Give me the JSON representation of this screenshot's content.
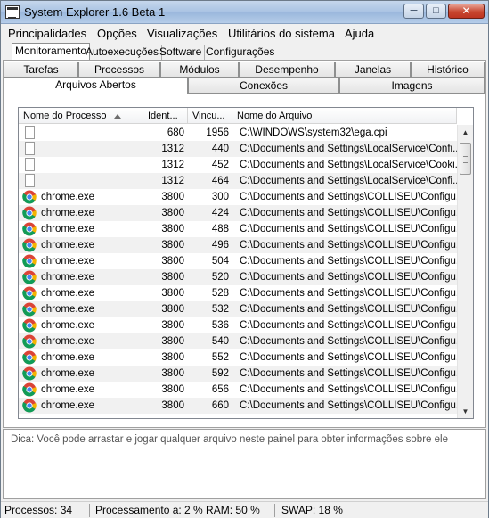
{
  "window": {
    "title": "System Explorer 1.6 Beta 1",
    "min_label": "─",
    "max_label": "□",
    "close_label": "✕"
  },
  "menu": [
    "Principalidades",
    "Opções",
    "Visualizações",
    "Utilitários do sistema",
    "Ajuda"
  ],
  "top_tabs": [
    "Monitoramento",
    "Autoexecuções",
    "Software",
    "Configurações"
  ],
  "tabs_row1": [
    "Tarefas",
    "Processos",
    "Módulos",
    "Desempenho",
    "Janelas",
    "Histórico"
  ],
  "tabs_row2": [
    "Arquivos Abertos",
    "Conexões",
    "Imagens"
  ],
  "columns": [
    "Nome do Processo",
    "Ident...",
    "Vincu...",
    "Nome do Arquivo"
  ],
  "rows": [
    {
      "name": "",
      "pid": "680",
      "link": "1956",
      "file": "C:\\WINDOWS\\system32\\ega.cpi",
      "icon": "document-icon"
    },
    {
      "name": "",
      "pid": "1312",
      "link": "440",
      "file": "C:\\Documents and Settings\\LocalService\\Confi...",
      "icon": "document-icon"
    },
    {
      "name": "",
      "pid": "1312",
      "link": "452",
      "file": "C:\\Documents and Settings\\LocalService\\Cooki...",
      "icon": "document-icon"
    },
    {
      "name": "",
      "pid": "1312",
      "link": "464",
      "file": "C:\\Documents and Settings\\LocalService\\Confi...",
      "icon": "document-icon"
    },
    {
      "name": "chrome.exe",
      "pid": "3800",
      "link": "300",
      "file": "C:\\Documents and Settings\\COLLISEU\\Configu...",
      "icon": "chrome-icon"
    },
    {
      "name": "chrome.exe",
      "pid": "3800",
      "link": "424",
      "file": "C:\\Documents and Settings\\COLLISEU\\Configu...",
      "icon": "chrome-icon"
    },
    {
      "name": "chrome.exe",
      "pid": "3800",
      "link": "488",
      "file": "C:\\Documents and Settings\\COLLISEU\\Configu...",
      "icon": "chrome-icon"
    },
    {
      "name": "chrome.exe",
      "pid": "3800",
      "link": "496",
      "file": "C:\\Documents and Settings\\COLLISEU\\Configu...",
      "icon": "chrome-icon"
    },
    {
      "name": "chrome.exe",
      "pid": "3800",
      "link": "504",
      "file": "C:\\Documents and Settings\\COLLISEU\\Configu...",
      "icon": "chrome-icon"
    },
    {
      "name": "chrome.exe",
      "pid": "3800",
      "link": "520",
      "file": "C:\\Documents and Settings\\COLLISEU\\Configu...",
      "icon": "chrome-icon"
    },
    {
      "name": "chrome.exe",
      "pid": "3800",
      "link": "528",
      "file": "C:\\Documents and Settings\\COLLISEU\\Configu...",
      "icon": "chrome-icon"
    },
    {
      "name": "chrome.exe",
      "pid": "3800",
      "link": "532",
      "file": "C:\\Documents and Settings\\COLLISEU\\Configu...",
      "icon": "chrome-icon"
    },
    {
      "name": "chrome.exe",
      "pid": "3800",
      "link": "536",
      "file": "C:\\Documents and Settings\\COLLISEU\\Configu...",
      "icon": "chrome-icon"
    },
    {
      "name": "chrome.exe",
      "pid": "3800",
      "link": "540",
      "file": "C:\\Documents and Settings\\COLLISEU\\Configu...",
      "icon": "chrome-icon"
    },
    {
      "name": "chrome.exe",
      "pid": "3800",
      "link": "552",
      "file": "C:\\Documents and Settings\\COLLISEU\\Configu...",
      "icon": "chrome-icon"
    },
    {
      "name": "chrome.exe",
      "pid": "3800",
      "link": "592",
      "file": "C:\\Documents and Settings\\COLLISEU\\Configu...",
      "icon": "chrome-icon"
    },
    {
      "name": "chrome.exe",
      "pid": "3800",
      "link": "656",
      "file": "C:\\Documents and Settings\\COLLISEU\\Configu...",
      "icon": "chrome-icon"
    },
    {
      "name": "chrome.exe",
      "pid": "3800",
      "link": "660",
      "file": "C:\\Documents and Settings\\COLLISEU\\Configu...",
      "icon": "chrome-icon"
    }
  ],
  "hint": "Dica: Você pode arrastar e jogar qualquer arquivo neste painel para obter informações sobre ele",
  "status": {
    "processes": "Processos: 34",
    "cpu_ram": "Processamento a: 2 %  RAM: 50 %",
    "swap": "SWAP: 18 %"
  },
  "scrollbar": {
    "up_label": "▲",
    "down_label": "▼"
  },
  "colors": {
    "title_bar": "#a9c3e3",
    "close_button": "#c8452f",
    "row_alt": "#f1f1f1"
  }
}
